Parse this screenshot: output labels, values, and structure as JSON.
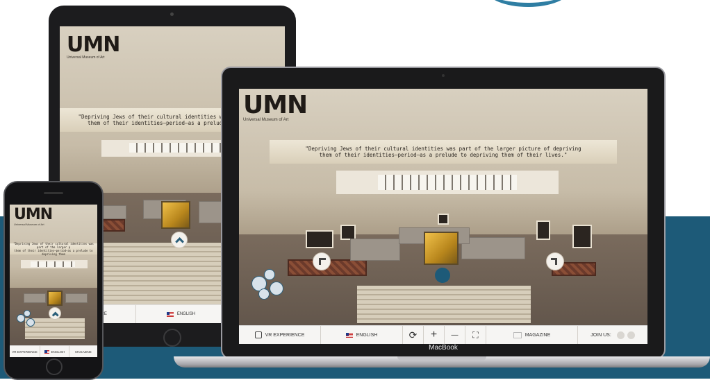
{
  "colors": {
    "accent": "#1d5a78",
    "toolbar_bg": "#f6f5f3",
    "device_frame": "#1c1c1e"
  },
  "brand": {
    "logo": "UMN",
    "subtitle": "Universal Museum of Art"
  },
  "quote": {
    "line1": "\"Depriving Jews of their cultural identities was part of the larger picture of depriving",
    "line2": "them of their identities—period—as a prelude to depriving them of their lives.\"",
    "tablet_line1": "\"Depriving Jews of their cultural identities was part of the",
    "tablet_line2": "them of their identities—period—as a prelude to depriv",
    "phone_line1": "\"Depriving Jews of their cultural identities was part of the larger p",
    "phone_line2": "them of their identities—period—as a prelude to depriving them"
  },
  "toolbar": {
    "vr_label": "VR EXPERIENCE",
    "vr_label_tablet": "ERIENCE",
    "language_label": "ENGLISH",
    "magazine_label": "MAGAZINE",
    "join_label": "JOIN US:",
    "rotate_icon": "⟳",
    "zoom_in_icon": "+",
    "zoom_out_icon": "—",
    "fullscreen_icon": "⛶"
  },
  "phone_toolbar": {
    "vr_label": "VR EXPERIENCE",
    "language_label": "ENGLISH",
    "magazine_label": "MAGAZINE"
  },
  "device": {
    "laptop_brand": "MacBook"
  }
}
